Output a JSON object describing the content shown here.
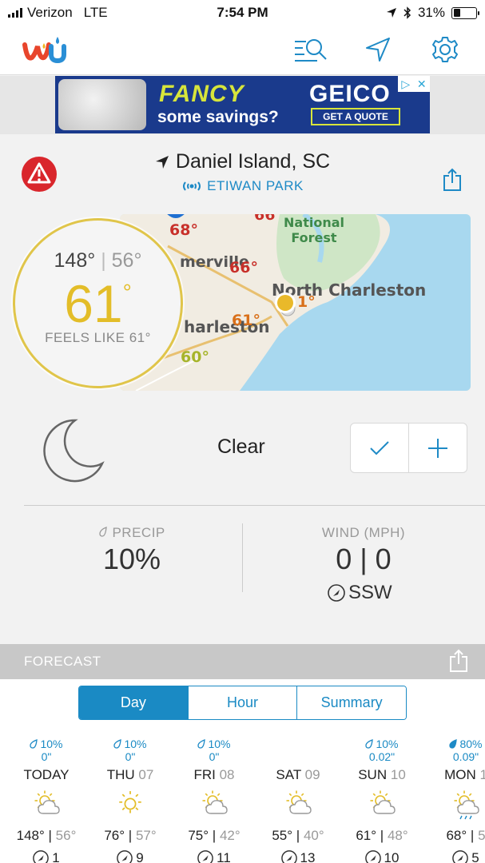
{
  "status": {
    "carrier": "Verizon",
    "network": "LTE",
    "time": "7:54 PM",
    "battery": "31%",
    "battery_level": 0.31
  },
  "nav": {
    "logo": "wu",
    "icons": [
      "search-list-icon",
      "location-arrow-icon",
      "gear-icon"
    ]
  },
  "ad": {
    "headline": "FANCY",
    "subline": "some savings?",
    "brand": "GEICO",
    "cta": "GET A QUOTE"
  },
  "location": {
    "city": "Daniel Island, SC",
    "station": "ETIWAN PARK"
  },
  "map": {
    "labels": {
      "national_forest": "National\nForest",
      "north_charleston": "North Charleston",
      "summerville": "merville",
      "charleston": "harleston"
    },
    "temps": {
      "t1": "68°",
      "t2": "66°",
      "t3": "66°",
      "t4": "61°",
      "t5": "60°",
      "t6": "1°"
    }
  },
  "current": {
    "high": "148°",
    "low": "56°",
    "temp": "61",
    "feels_like": "FEELS LIKE 61°",
    "condition": "Clear"
  },
  "stats": {
    "precip_label": "PRECIP",
    "precip_value": "10%",
    "wind_label": "WIND (MPH)",
    "wind_value": "0 | 0",
    "wind_dir": "SSW"
  },
  "forecast": {
    "title": "FORECAST",
    "tabs": [
      "Day",
      "Hour",
      "Summary"
    ],
    "active_tab": "Day",
    "days": [
      {
        "pop": "10%",
        "amount": "0\"",
        "name": "TODAY",
        "date": "",
        "icon": "partly-cloudy-icon",
        "hi": "148°",
        "lo": "56°",
        "wind": "1"
      },
      {
        "pop": "10%",
        "amount": "0\"",
        "name": "THU",
        "date": "07",
        "icon": "sunny-icon",
        "hi": "76°",
        "lo": "57°",
        "wind": "9"
      },
      {
        "pop": "10%",
        "amount": "0\"",
        "name": "FRI",
        "date": "08",
        "icon": "partly-cloudy-icon",
        "hi": "75°",
        "lo": "42°",
        "wind": "11"
      },
      {
        "pop": "",
        "amount": "",
        "name": "SAT",
        "date": "09",
        "icon": "partly-cloudy-icon",
        "hi": "55°",
        "lo": "40°",
        "wind": "13"
      },
      {
        "pop": "10%",
        "amount": "0.02\"",
        "name": "SUN",
        "date": "10",
        "icon": "partly-cloudy-icon",
        "hi": "61°",
        "lo": "48°",
        "wind": "10"
      },
      {
        "pop": "80%",
        "amount": "0.09\"",
        "name": "MON",
        "date": "1",
        "icon": "rain-icon",
        "hi": "68°",
        "lo": "5",
        "wind": "5"
      }
    ]
  },
  "colors": {
    "accent": "#1a8ac4",
    "temp": "#e3bd28",
    "alert": "#d9262c"
  }
}
